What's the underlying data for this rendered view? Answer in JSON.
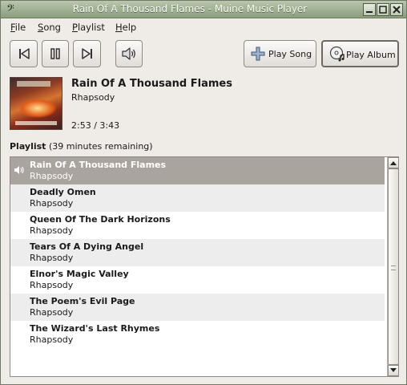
{
  "window": {
    "title": "Rain Of A Thousand Flames - Muine Music Player",
    "app_icon": "bass-clef-icon",
    "controls": {
      "minimize": "minimize-icon",
      "maximize": "maximize-icon",
      "close": "close-icon"
    }
  },
  "menubar": {
    "items": [
      {
        "label": "File",
        "mnemonic": "F",
        "rest": "ile"
      },
      {
        "label": "Song",
        "mnemonic": "S",
        "rest": "ong"
      },
      {
        "label": "Playlist",
        "mnemonic": "P",
        "rest": "laylist"
      },
      {
        "label": "Help",
        "mnemonic": "H",
        "rest": "elp"
      }
    ]
  },
  "toolbar": {
    "previous_icon": "skip-previous-icon",
    "pause_icon": "pause-icon",
    "next_icon": "skip-next-icon",
    "volume_icon": "speaker-volume-icon",
    "play_song_label": "Play Song",
    "play_album_label": "Play Album"
  },
  "now_playing": {
    "title": "Rain Of A Thousand Flames",
    "artist": "Rhapsody",
    "time": "2:53 / 3:43"
  },
  "playlist": {
    "heading": "Playlist",
    "remaining": "(39 minutes remaining)",
    "current_index": 0,
    "items": [
      {
        "title": "Rain Of A Thousand Flames",
        "artist": "Rhapsody"
      },
      {
        "title": "Deadly Omen",
        "artist": "Rhapsody"
      },
      {
        "title": "Queen Of The Dark Horizons",
        "artist": "Rhapsody"
      },
      {
        "title": "Tears Of A Dying Angel",
        "artist": "Rhapsody"
      },
      {
        "title": "Elnor's Magic Valley",
        "artist": "Rhapsody"
      },
      {
        "title": "The Poem's Evil Page",
        "artist": "Rhapsody"
      },
      {
        "title": "The Wizard's Last Rhymes",
        "artist": "Rhapsody"
      }
    ]
  },
  "colors": {
    "titlebar": "#9aab8c",
    "selected_row": "#a9a49e",
    "alt_row": "#ededed"
  }
}
